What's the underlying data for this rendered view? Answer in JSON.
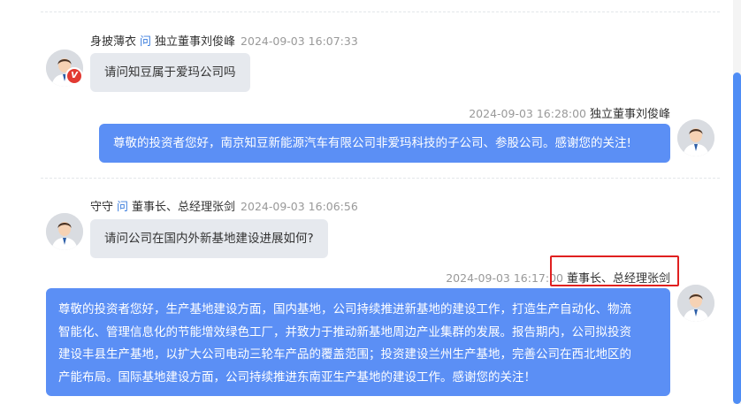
{
  "qa": [
    {
      "asker": "身披薄衣",
      "ask_word": "问",
      "target": "独立董事刘俊峰",
      "question_time": "2024-09-03 16:07:33",
      "question": "请问知豆属于爱玛公司吗",
      "verified_badge": "V",
      "answer_time": "2024-09-03 16:28:00",
      "answerer": "独立董事刘俊峰",
      "answer": "尊敬的投资者您好，南京知豆新能源汽车有限公司非爱玛科技的子公司、参股公司。感谢您的关注!"
    },
    {
      "asker": "守守",
      "ask_word": "问",
      "target": "董事长、总经理张剑",
      "question_time": "2024-09-03 16:06:56",
      "question": "请问公司在国内外新基地建设进展如何?",
      "answer_time": "2024-09-03 16:17:00",
      "answerer": "董事长、总经理张剑",
      "answer_lines": [
        "尊敬的投资者您好，生产基地建设方面，国内基地，公司持续推进新基地的建设工作，打造生产自动化、物流",
        "智能化、管理信息化的节能增效绿色工厂，并致力于推动新基地周边产业集群的发展。报告期内，公司拟投资",
        "建设丰县生产基地，以扩大公司电动三轮车产品的覆盖范围；投资建设兰州生产基地，完善公司在西北地区的",
        "产能布局。国际基地建设方面，公司持续推进东南亚生产基地的建设工作。感谢您的关注！"
      ]
    }
  ],
  "colors": {
    "answer_bubble": "#5b8ff5",
    "question_bubble": "#e6e9ee",
    "ask_word": "#3b7ddd",
    "highlight": "#e02020",
    "scroll_thumb": "#4f8df5"
  }
}
